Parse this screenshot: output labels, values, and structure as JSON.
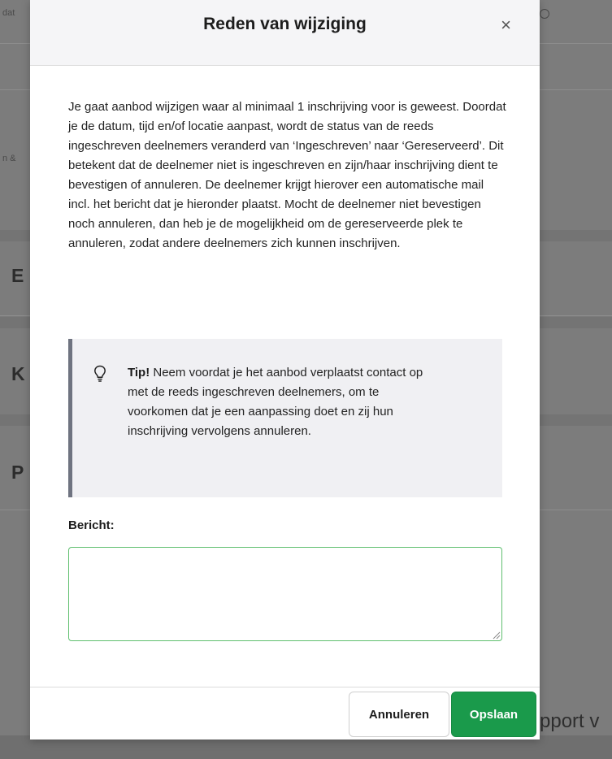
{
  "background": {
    "top_left_fragment": "dat",
    "side_fragment": "n &",
    "section_letters": [
      "E",
      "K",
      "P"
    ],
    "bottom_right_text": "pport v"
  },
  "modal": {
    "title": "Reden van wijziging",
    "close_glyph": "×",
    "intro_text": "Je gaat aanbod wijzigen waar al minimaal 1 inschrijving voor is geweest. Doordat je de datum, tijd en/of locatie aanpast, wordt de status van de reeds ingeschreven deelnemers veranderd van ‘Ingeschreven’ naar ‘Gereserveerd’. Dit betekent dat de deelnemer niet is ingeschreven en zijn/haar inschrijving dient te bevestigen of annuleren. De deelnemer krijgt hierover een automatische mail incl. het bericht dat je hieronder plaatst. Mocht de deelnemer niet bevestigen noch annuleren, dan heb je de mogelijkheid om de gereserveerde plek te annuleren, zodat andere deelnemers zich kunnen inschrijven.",
    "tip": {
      "icon": "lightbulb-icon",
      "label": "Tip!",
      "text": " Neem voordat je het aanbod verplaatst contact op met de reeds ingeschreven deelnemers, om te voorkomen dat je een aanpassing doet en zij hun inschrijving vervolgens annuleren."
    },
    "message_label": "Bericht:",
    "message_value": "",
    "buttons": {
      "cancel": "Annuleren",
      "save": "Opslaan"
    }
  },
  "colors": {
    "save_button": "#1a9a4b",
    "input_border": "#5fbf6f",
    "tip_border": "#6f7380",
    "overlay": "#7c7c7c"
  }
}
